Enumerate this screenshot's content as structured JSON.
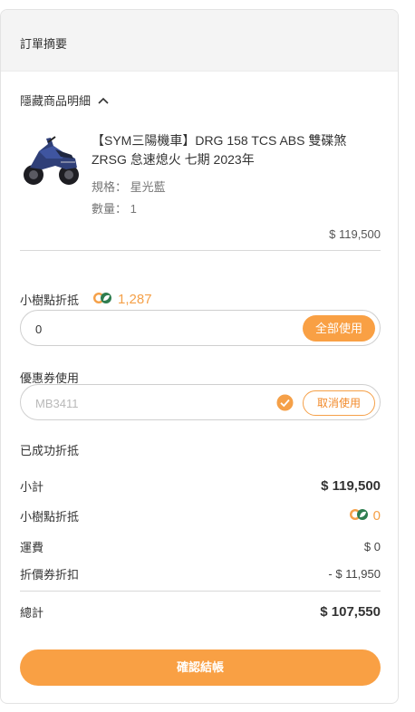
{
  "header": {
    "title": "訂單摘要"
  },
  "toggle": {
    "label": "隱藏商品明細",
    "icon": "chevron-up-icon"
  },
  "product": {
    "title": "【SYM三陽機車】DRG 158 TCS ABS 雙碟煞 ZRSG 怠速熄火 七期 2023年",
    "spec": "規格： 星光藍",
    "qty": "數量： 1",
    "price": "$ 119,500",
    "image_icon": "scooter-image"
  },
  "points": {
    "label": "小樹點折抵",
    "available": "1,287",
    "input_value": "0",
    "use_all_label": "全部使用",
    "icon": "tree-point-coin-icon"
  },
  "coupon": {
    "label": "優惠券使用",
    "placeholder": "MB3411",
    "cancel_label": "取消使用",
    "status": "已成功折抵",
    "icon": "check-circle-icon"
  },
  "summary": {
    "subtotal_label": "小計",
    "subtotal_value": "$ 119,500",
    "points_label": "小樹點折抵",
    "points_value": "0",
    "shipping_label": "運費",
    "shipping_value": "$ 0",
    "coupon_label": "折價券折扣",
    "coupon_value": "- $ 11,950",
    "total_label": "總計",
    "total_value": "$ 107,550"
  },
  "checkout": {
    "label": "確認結帳"
  },
  "colors": {
    "accent": "#f9a044",
    "points_text": "#f5a048",
    "leaf_green": "#2e7d4f"
  }
}
